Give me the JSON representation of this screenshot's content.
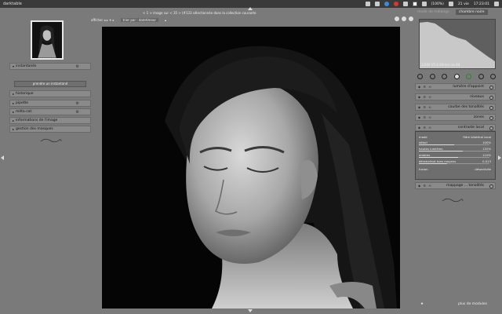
{
  "app": {
    "title": "darktable"
  },
  "tray": {
    "battery": "(100%)",
    "date": "21 vie",
    "time": "17:23:01"
  },
  "left_panel": {
    "thumb_info": "f 2.8",
    "modules": [
      {
        "label": "instantanés",
        "expanded": true,
        "gear": "⚙"
      },
      {
        "label": "historique",
        "expanded": false,
        "gear": ""
      },
      {
        "label": "pipette",
        "expanded": false,
        "gear": "⚙"
      },
      {
        "label": "méta-cat",
        "expanded": false,
        "gear": "⚙"
      },
      {
        "label": "informations de l'image",
        "expanded": false,
        "gear": ""
      },
      {
        "label": "gestion des masques",
        "expanded": false,
        "gear": ""
      }
    ],
    "snapshot_button": "prendre un instantané"
  },
  "center": {
    "info_text": "< 1 > image sur < 35 > (#133 sélectionnée dans la collection courante",
    "toolbar": {
      "afficher": "afficher ◂ ▸ ✦ ▸",
      "sort": "trier par : datetimeor",
      "sort_arrow": "▴"
    }
  },
  "right_panel": {
    "tabs": {
      "inactive": "mode de mélange",
      "active": "chambre noire"
    },
    "histogram_colors": {
      "fill": "#c8c8c8",
      "bg": "#5f5f5f"
    },
    "exif": "1/200 f/5.6 85mm iso 64",
    "modules": [
      {
        "label": "lumière d'appoint"
      },
      {
        "label": "niveaux"
      },
      {
        "label": "courbe des tonalités"
      },
      {
        "label": "zones"
      },
      {
        "label": "contraste local"
      }
    ],
    "local_contrast": {
      "params": [
        {
          "label": "mode",
          "value": "filtre bilatéral local",
          "fill": 0
        },
        {
          "label": "détail",
          "value": "100%",
          "fill": 0.5
        },
        {
          "label": "hautes lumières",
          "value": "132%",
          "fill": 0.62
        },
        {
          "label": "ombres",
          "value": "110%",
          "fill": 0.55
        },
        {
          "label": "dératurfaut tons moyens",
          "value": "0.013",
          "fill": 0.4
        },
        {
          "label": "fusion",
          "value": "désactivée",
          "fill": 0
        }
      ]
    },
    "bottom_module": "mappage ... tonalités",
    "more_modules": "plus de modules"
  }
}
